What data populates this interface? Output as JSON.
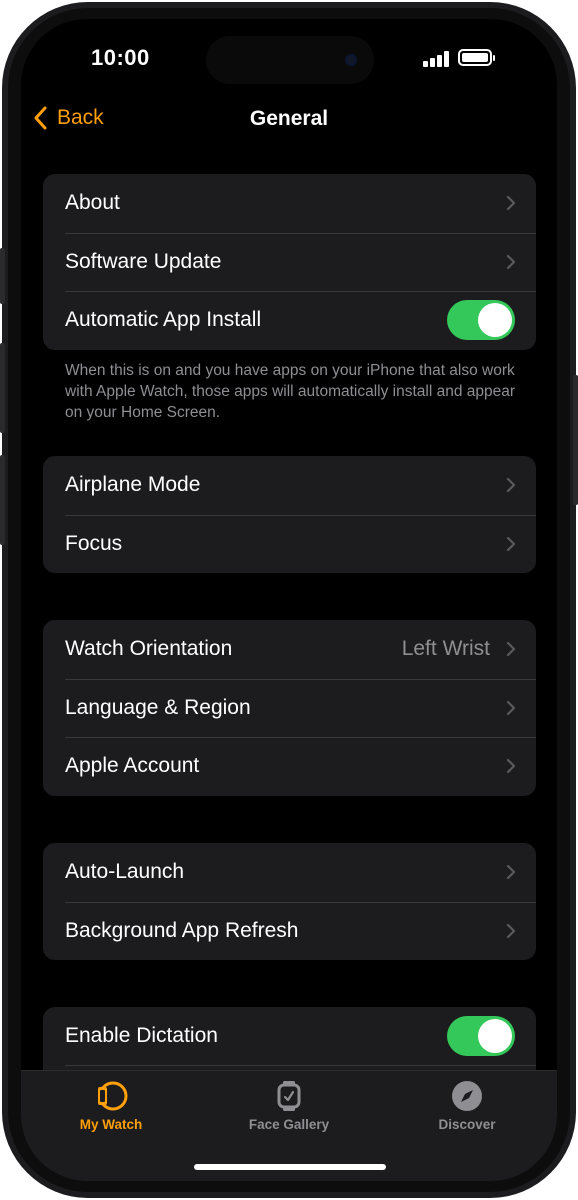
{
  "status": {
    "time": "10:00"
  },
  "nav": {
    "back_label": "Back",
    "title": "General"
  },
  "groups": [
    {
      "rows": [
        {
          "label": "About",
          "type": "chevron"
        },
        {
          "label": "Software Update",
          "type": "chevron"
        },
        {
          "label": "Automatic App Install",
          "type": "toggle",
          "on": true
        }
      ]
    },
    {
      "rows": [
        {
          "label": "Airplane Mode",
          "type": "chevron"
        },
        {
          "label": "Focus",
          "type": "chevron"
        }
      ]
    },
    {
      "rows": [
        {
          "label": "Watch Orientation",
          "type": "chevron",
          "value": "Left Wrist"
        },
        {
          "label": "Language & Region",
          "type": "chevron"
        },
        {
          "label": "Apple Account",
          "type": "chevron"
        }
      ]
    },
    {
      "rows": [
        {
          "label": "Auto-Launch",
          "type": "chevron"
        },
        {
          "label": "Background App Refresh",
          "type": "chevron"
        }
      ]
    },
    {
      "rows": [
        {
          "label": "Enable Dictation",
          "type": "toggle",
          "on": true
        }
      ]
    }
  ],
  "footnote": "When this is on and you have apps on your iPhone that also work with Apple Watch, those apps will automatically install and appear on your Home Screen.",
  "tabbar": {
    "items": [
      {
        "label": "My Watch",
        "active": true,
        "icon": "watch-side-icon"
      },
      {
        "label": "Face Gallery",
        "active": false,
        "icon": "watch-face-icon"
      },
      {
        "label": "Discover",
        "active": false,
        "icon": "compass-icon"
      }
    ]
  },
  "colors": {
    "accent": "#ff9f0a",
    "toggle_on": "#34c759",
    "cell_bg": "#1c1c1e",
    "secondary_text": "#8e8e93"
  }
}
